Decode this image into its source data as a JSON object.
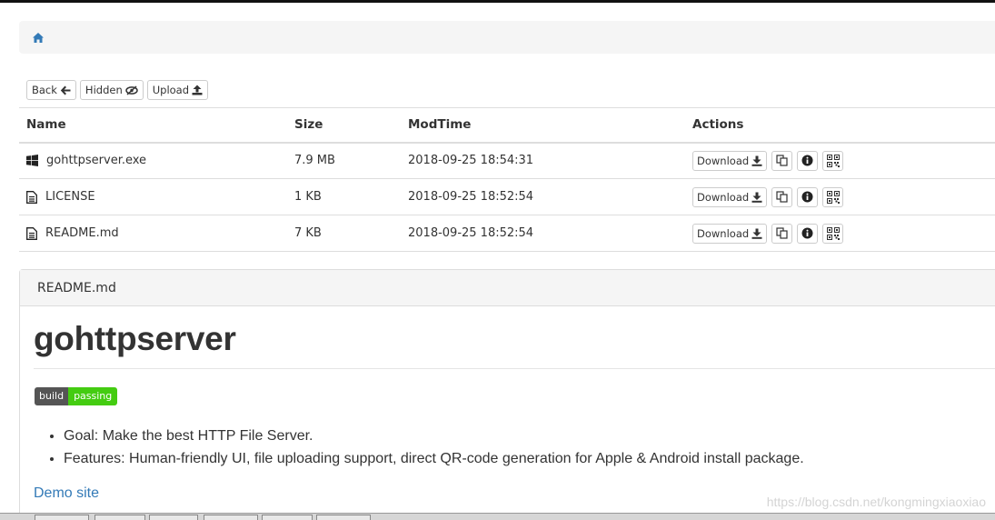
{
  "breadcrumb": {
    "home_icon": "home-icon"
  },
  "toolbar": {
    "back_label": "Back",
    "hidden_label": "Hidden",
    "upload_label": "Upload"
  },
  "table": {
    "headers": [
      "Name",
      "Size",
      "ModTime",
      "Actions"
    ],
    "rows": [
      {
        "icon": "windows-icon",
        "name": "gohttpserver.exe",
        "size": "7.9 MB",
        "modtime": "2018-09-25 18:54:31",
        "download_label": "Download"
      },
      {
        "icon": "file-text-icon",
        "name": "LICENSE",
        "size": "1 KB",
        "modtime": "2018-09-25 18:52:54",
        "download_label": "Download"
      },
      {
        "icon": "file-text-icon",
        "name": "README.md",
        "size": "7 KB",
        "modtime": "2018-09-25 18:52:54",
        "download_label": "Download"
      }
    ]
  },
  "readme": {
    "heading": "README.md",
    "title": "gohttpserver",
    "badge_left": "build",
    "badge_right": "passing",
    "items": [
      "Goal: Make the best HTTP File Server.",
      "Features: Human-friendly UI, file uploading support, direct QR-code generation for Apple & Android install package."
    ],
    "link": "Demo site"
  },
  "watermark": "https://blog.csdn.net/kongmingxiaoxiao",
  "colors": {
    "link": "#337ab7",
    "badge_pass": "#44cc11",
    "badge_label": "#555555"
  }
}
